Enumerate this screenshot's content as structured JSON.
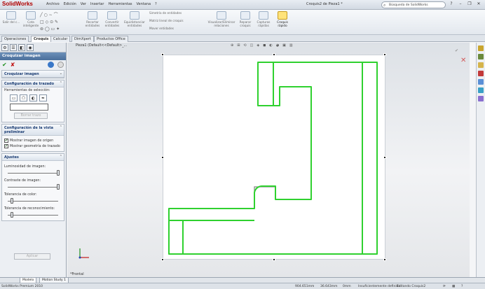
{
  "app": {
    "logo": "SolidWorks",
    "menu": [
      "Archivo",
      "Edición",
      "Ver",
      "Insertar",
      "Herramientas",
      "Ventana",
      "?"
    ],
    "document_title": "Croquis2 de Pieza1 *",
    "search_placeholder": "Búsqueda de SolidWorks"
  },
  "ribbon": {
    "buttons": [
      {
        "label": "Salir del c...",
        "icon": "exit-sketch-icon"
      },
      {
        "label": "Cota inteligente",
        "icon": "smart-dimension-icon"
      },
      {
        "label": "Recortar entidades",
        "icon": "trim-icon"
      },
      {
        "label": "Convertir entidades",
        "icon": "convert-icon"
      },
      {
        "label": "Equidistanciar entidades",
        "icon": "offset-icon"
      },
      {
        "label": "Simetría de entidades",
        "icon": "mirror-icon"
      },
      {
        "label": "Matriz lineal de croquis",
        "icon": "linear-pattern-icon"
      },
      {
        "label": "Mover entidades",
        "icon": "move-icon"
      },
      {
        "label": "Visualizar/Eliminar relaciones",
        "icon": "relations-icon"
      },
      {
        "label": "Reparar croquis",
        "icon": "repair-icon"
      },
      {
        "label": "Capturas rápidas",
        "icon": "snaps-icon"
      },
      {
        "label": "Croquis rápido",
        "icon": "rapid-sketch-icon"
      }
    ]
  },
  "tabs": [
    "Operaciones",
    "Croquis",
    "Calcular",
    "DimXpert",
    "Productos Office"
  ],
  "panel": {
    "title": "Croquizar imagen",
    "section_main": "Croquizar imagen",
    "trace": {
      "header": "Configuración de trazado",
      "tools_label": "Herramientas de selección:",
      "clear_button": "Borrar trazo"
    },
    "view": {
      "header": "Configuración de la vista preliminar",
      "show_source": "Mostrar imagen de origen",
      "show_trace": "Mostrar geometría de trazado"
    },
    "adjust": {
      "header": "Ajustes",
      "brightness": "Luminosidad de imagen:",
      "contrast": "Contraste de imagen:",
      "color_tol": "Tolerancia de color:",
      "recog_tol": "Tolerancia de reconocimiento:",
      "apply": "Aplicar"
    }
  },
  "viewport": {
    "breadcrumb": "Pieza1 (Default<<Default>_...",
    "mode_label": "*Frontal"
  },
  "bottom_tabs": [
    "Modelo",
    "Motion Study 1"
  ],
  "status": {
    "app": "SolidWorks Premium 2010",
    "x": "904.651mm",
    "y": "36.643mm",
    "z": "0mm",
    "state": "Insuficientemente definido",
    "editing": "Editando Croquis2"
  }
}
